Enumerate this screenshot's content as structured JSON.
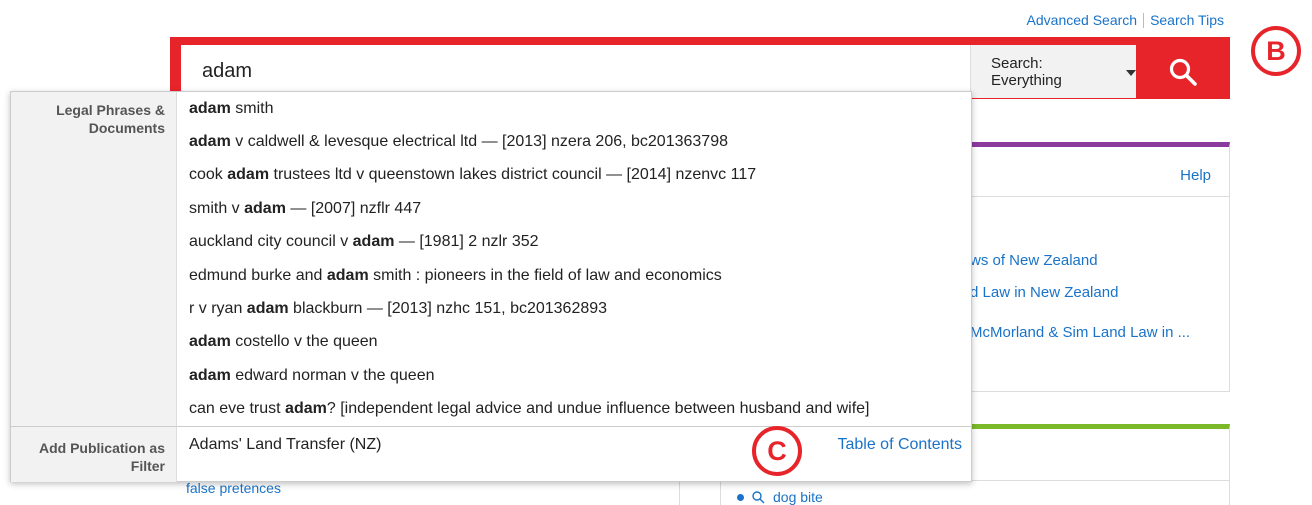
{
  "top_links": {
    "advanced": "Advanced Search",
    "tips": "Search Tips"
  },
  "search": {
    "value": "adam",
    "scope_label": "Search: Everything",
    "button_icon": "search-icon"
  },
  "callouts": {
    "b": "B",
    "c": "C"
  },
  "background": {
    "help": "Help",
    "links": [
      "ws of New Zealand",
      "d Law in New Zealand",
      "McMorland & Sim Land Law in ..."
    ],
    "left_links": [
      "false pretences",
      ""
    ],
    "right_link": "dog bite"
  },
  "dropdown": {
    "section1_label": "Legal Phrases & Documents",
    "section2_label": "Add Publication as Filter",
    "suggestions": [
      {
        "pre": "",
        "bold": "adam",
        "post": " smith"
      },
      {
        "pre": "",
        "bold": "adam",
        "post": " v caldwell & levesque electrical ltd — [2013] nzera 206, bc201363798"
      },
      {
        "pre": "cook ",
        "bold": "adam",
        "post": " trustees ltd v queenstown lakes district council — [2014] nzenvc 117"
      },
      {
        "pre": "smith v ",
        "bold": "adam",
        "post": " — [2007] nzflr 447"
      },
      {
        "pre": "auckland city council v ",
        "bold": "adam",
        "post": " — [1981] 2 nzlr 352"
      },
      {
        "pre": "edmund burke and ",
        "bold": "adam",
        "post": " smith : pioneers in the field of law and economics"
      },
      {
        "pre": "r v ryan ",
        "bold": "adam",
        "post": " blackburn — [2013] nzhc 151, bc201362893"
      },
      {
        "pre": "",
        "bold": "adam",
        "post": " costello v the queen"
      },
      {
        "pre": "",
        "bold": "adam",
        "post": " edward norman v the queen"
      },
      {
        "pre": "can eve trust ",
        "bold": "adam",
        "post": "? [independent legal advice and undue influence between husband and wife]"
      }
    ],
    "publication": {
      "title": "Adams' Land Transfer (NZ)",
      "toc": "Table of Contents"
    }
  },
  "colors": {
    "accent_red": "#e8242b",
    "link_blue": "#1a73c8",
    "purple": "#8b3a9e",
    "green": "#7cb92a"
  }
}
